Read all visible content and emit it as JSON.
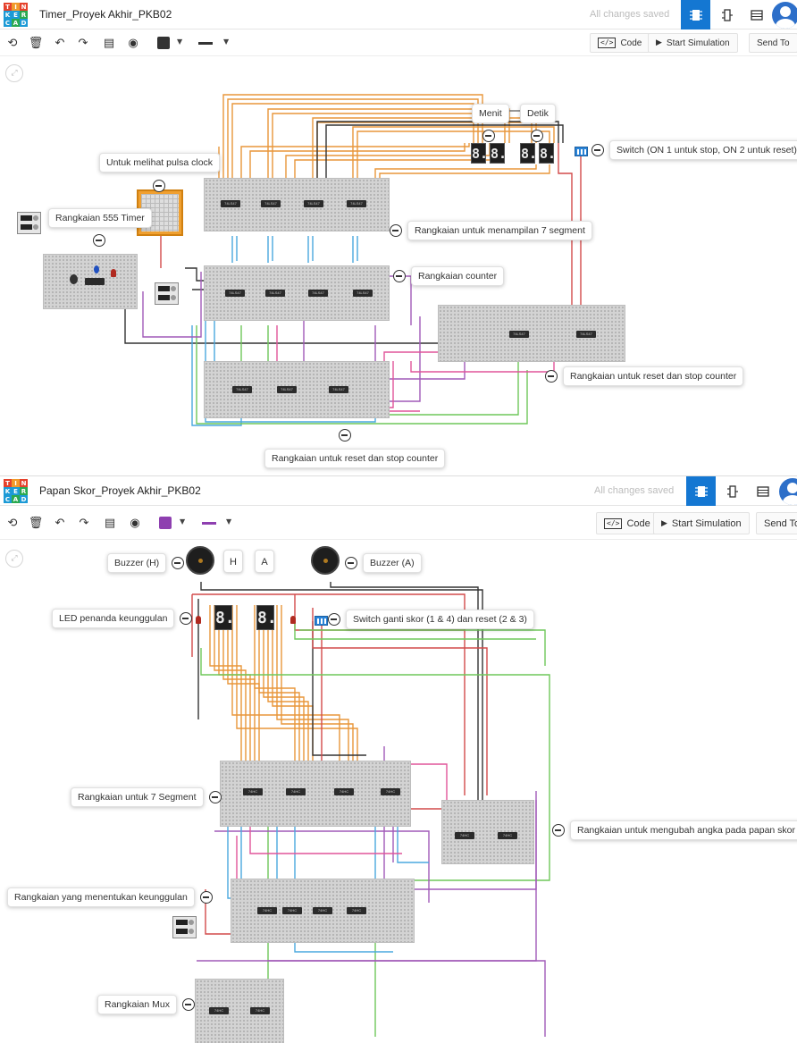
{
  "colors": {
    "accent_blue": "#1477d2",
    "wire_orange": "#e8963a",
    "wire_blue": "#4aa8df",
    "wire_green": "#6fc75a",
    "wire_purple": "#a15ab8",
    "wire_pink": "#e0559a",
    "wire_red": "#d24a4a",
    "wire_dark": "#333333",
    "color_swatch_1": "#333333",
    "color_swatch_2": "#8e3fb0"
  },
  "logo": {
    "letters": [
      "T",
      "I",
      "N",
      "K",
      "E",
      "R",
      "C",
      "A",
      "D"
    ]
  },
  "toolbar": {
    "code_label": "Code",
    "start_label": "Start Simulation",
    "send_label": "Send To",
    "icons": [
      "rotate-icon",
      "trash-icon",
      "undo-icon",
      "redo-icon",
      "notes-icon",
      "eye-icon",
      "color-swatch",
      "line-style-icon"
    ]
  },
  "screens": [
    {
      "title": "Timer_Proyek Akhir_PKB02",
      "saved_status": "All changes saved",
      "annotations": {
        "menit": "Menit",
        "detik": "Detik",
        "switch": "Switch (ON 1 untuk stop, ON 2 untuk reset)",
        "pulsa": "Untuk melihat pulsa clock",
        "timer555": "Rangkaian 555 Timer",
        "display7": "Rangkaian untuk menampilan 7 segment",
        "counter": "Rangkaian counter",
        "reset_right": "Rangkaian untuk reset dan stop counter",
        "reset_bottom": "Rangkaian untuk reset dan stop counter"
      },
      "digits": [
        "8.",
        "8.",
        "8.",
        "8."
      ],
      "chip_label": "74LS47"
    },
    {
      "title": "Papan Skor_Proyek Akhir_PKB02",
      "saved_status": "All changes saved",
      "annotations": {
        "buzzer_h": "Buzzer (H)",
        "buzzer_a": "Buzzer (A)",
        "h": "H",
        "a": "A",
        "led": "LED penanda keunggulan",
        "switch": "Switch ganti skor (1 & 4) dan reset (2 & 3)",
        "seg7": "Rangkaian untuk 7 Segment",
        "ubah": "Rangkaian untuk mengubah angka pada papan skor",
        "unggul": "Rangkaian yang menentukan keunggulan",
        "mux": "Rangkaian Mux"
      },
      "digits": [
        "8.",
        "8."
      ],
      "chip_label": "74HC"
    }
  ]
}
